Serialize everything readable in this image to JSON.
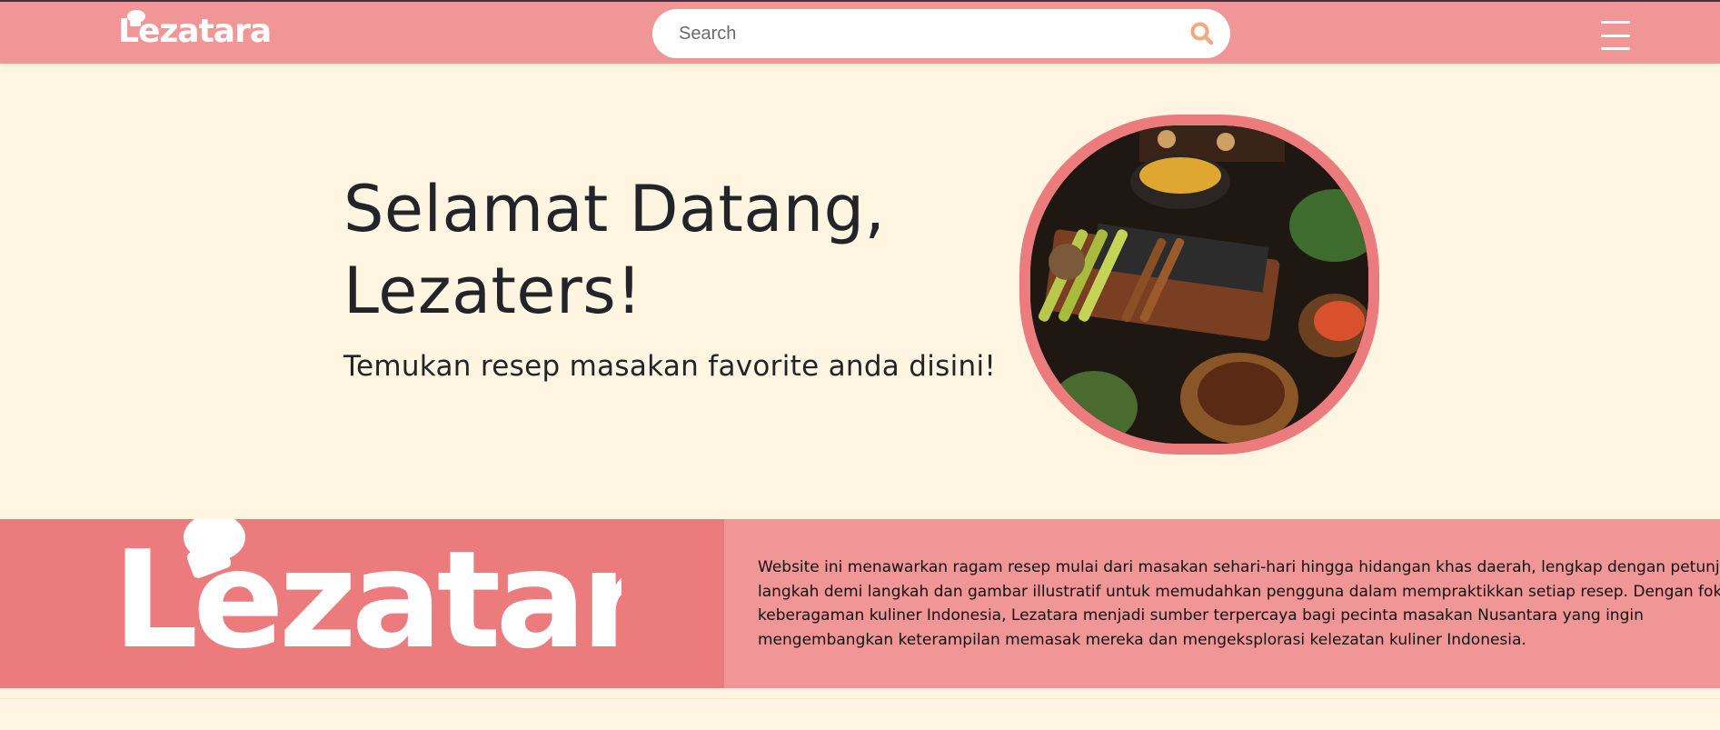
{
  "brand": {
    "name": "Lezatara",
    "color_primary": "#f09696",
    "color_accent": "#ec7b7e",
    "color_background": "#fff5e1"
  },
  "navbar": {
    "search_placeholder": "Search",
    "search_icon": "search-icon",
    "menu_icon": "hamburger-menu-icon"
  },
  "hero": {
    "title_line1": "Selamat Datang,",
    "title_line2": "Lezaters!",
    "subtitle": "Temukan resep masakan favorite anda disini!"
  },
  "about": {
    "lines": [
      "Website ini menawarkan ragam resep mulai dari masakan sehari-hari hingga hidangan khas daerah, lengkap dengan petunjuk",
      "langkah demi langkah dan gambar illustratif untuk memudahkan pengguna dalam mempraktikkan setiap resep. Dengan fokus pada",
      "keberagaman kuliner Indonesia, Lezatara menjadi sumber terpercaya bagi pecinta masakan Nusantara yang ingin",
      "mengembangkan keterampilan memasak mereka dan mengeksplorasi kelezatan kuliner Indonesia."
    ]
  }
}
